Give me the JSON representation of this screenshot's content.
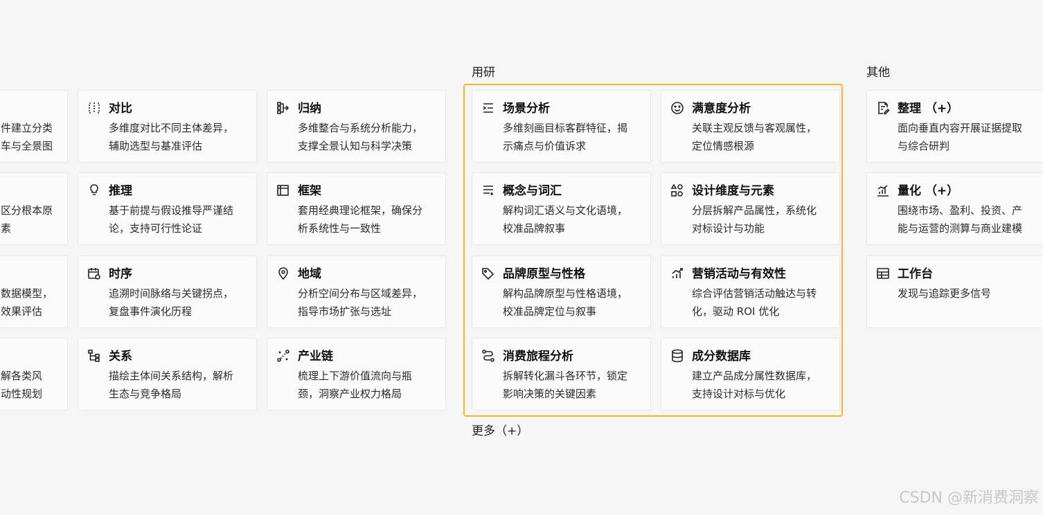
{
  "sections": {
    "user_research": "用研",
    "other": "其他",
    "more": "更多（+）"
  },
  "col1_partial": [
    {
      "line1": "件建立分类",
      "line2": "车与全景图"
    },
    {
      "line1": "区分根本原",
      "line2": "素"
    },
    {
      "line1": "数据模型，",
      "line2": "效果评估"
    },
    {
      "line1": "解各类风",
      "line2": "动性规划"
    }
  ],
  "col2": [
    {
      "icon": "compare-icon",
      "title": "对比",
      "line1": "多维度对比不同主体差异，",
      "line2": "辅助选型与基准评估"
    },
    {
      "icon": "lightbulb-icon",
      "title": "推理",
      "line1": "基于前提与假设推导严谨结",
      "line2": "论，支持可行性论证"
    },
    {
      "icon": "calendar-clock-icon",
      "title": "时序",
      "line1": "追溯时间脉络与关键拐点，",
      "line2": "复盘事件演化历程"
    },
    {
      "icon": "relation-tree-icon",
      "title": "关系",
      "line1": "描绘主体间关系结构，解析",
      "line2": "生态与竞争格局"
    }
  ],
  "col3": [
    {
      "icon": "merge-icon",
      "title": "归纳",
      "line1": "多维整合与系统分析能力，",
      "line2": "支撑全景认知与科学决策"
    },
    {
      "icon": "frame-icon",
      "title": "框架",
      "line1": "套用经典理论框架，确保分",
      "line2": "析系统性与一致性"
    },
    {
      "icon": "map-pin-icon",
      "title": "地域",
      "line1": "分析空间分布与区域差异，",
      "line2": "指导市场扩张与选址"
    },
    {
      "icon": "chain-icon",
      "title": "产业链",
      "line1": "梳理上下游价值流向与瓶",
      "line2": "颈，洞察产业权力格局"
    }
  ],
  "col4": [
    {
      "icon": "scene-list-icon",
      "title": "场景分析",
      "line1": "多维刻画目标客群特征，揭",
      "line2": "示痛点与价值诉求"
    },
    {
      "icon": "text-lines-icon",
      "title": "概念与词汇",
      "line1": "解构词汇语义与文化语境，",
      "line2": "校准品牌叙事"
    },
    {
      "icon": "tag-icon",
      "title": "品牌原型与性格",
      "line1": "解构品牌原型与性格语境，",
      "line2": "校准品牌定位与叙事"
    },
    {
      "icon": "journey-icon",
      "title": "消费旅程分析",
      "line1": "拆解转化漏斗各环节，锁定",
      "line2": "影响决策的关键因素"
    }
  ],
  "col5": [
    {
      "icon": "smile-icon",
      "title": "满意度分析",
      "line1": "关联主观反馈与客观属性，",
      "line2": "定位情感根源"
    },
    {
      "icon": "shapes-icon",
      "title": "设计维度与元素",
      "line1": "分层拆解产品属性，系统化",
      "line2": "对标设计与功能"
    },
    {
      "icon": "trend-bars-icon",
      "title": "营销活动与有效性",
      "line1": "综合评估营销活动触达与转",
      "line2": "化，驱动 ROI 优化"
    },
    {
      "icon": "database-icon",
      "title": "成分数据库",
      "line1": "建立产品成分属性数据库，",
      "line2": "支持设计对标与优化"
    }
  ],
  "col6": [
    {
      "icon": "document-edit-icon",
      "title": "整理 （+）",
      "line1": "面向垂直内容开展证据提取",
      "line2": "与综合研判"
    },
    {
      "icon": "bar-chart-icon",
      "title": "量化 （+）",
      "line1": "围绕市场、盈利、投资、产",
      "line2": "能与运营的测算与商业建模"
    },
    {
      "icon": "table-icon",
      "title": "工作台",
      "line1": "发现与追踪更多信号",
      "line2": ""
    }
  ],
  "watermark": "CSDN @新消费洞察"
}
